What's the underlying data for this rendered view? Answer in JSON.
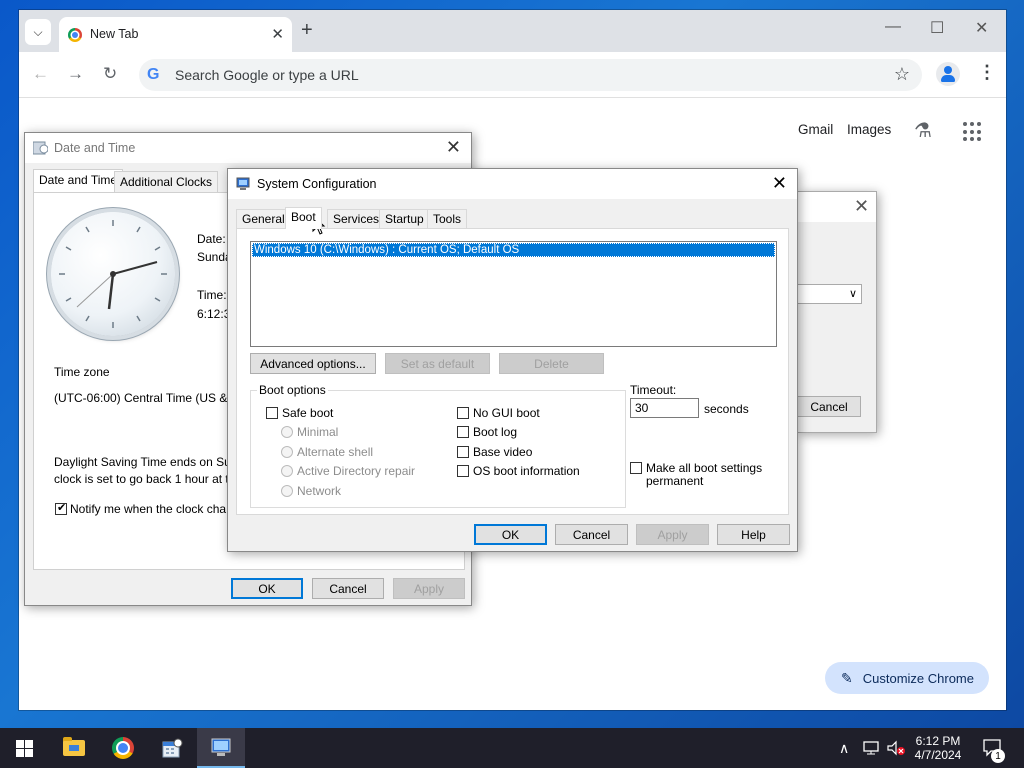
{
  "chrome": {
    "tab_title": "New Tab",
    "tab_close": "✕",
    "new_tab": "+",
    "omnibox_placeholder": "Search Google or type a URL",
    "g_logo": "G",
    "links": {
      "gmail": "Gmail",
      "images": "Images"
    },
    "customize_label": "Customize Chrome",
    "window_controls": {
      "minimize": "—",
      "maximize": "☐",
      "close": "✕"
    },
    "icons": [
      "tab-search-icon",
      "back-icon",
      "forward-icon",
      "reload-icon",
      "bookmark-star-icon",
      "profile-icon",
      "menu-icon",
      "labs-icon",
      "apps-icon",
      "pencil-icon"
    ]
  },
  "date_time_dialog": {
    "title": "Date and Time",
    "tabs": [
      "Date and Time",
      "Additional Clocks"
    ],
    "date_label": "Date:",
    "date_value": "Sunda",
    "time_label": "Time:",
    "time_value": "6:12:3",
    "timezone_label": "Time zone",
    "timezone_value": "(UTC-06:00) Central Time (US & C",
    "dst_line1": "Daylight Saving Time ends on Sur",
    "dst_line2": "clock is set to go back 1 hour at th",
    "notify_label": "Notify me when the clock cha",
    "notify_checked": true,
    "buttons": {
      "ok": "OK",
      "cancel": "Cancel",
      "apply": "Apply"
    }
  },
  "background_dialog": {
    "cancel": "Cancel"
  },
  "sysconfig": {
    "title": "System Configuration",
    "tabs": [
      "General",
      "Boot",
      "Services",
      "Startup",
      "Tools"
    ],
    "active_tab": "Boot",
    "boot_entries": [
      "Windows 10 (C:\\Windows) : Current OS; Default OS"
    ],
    "buttons_row": {
      "advanced": "Advanced options...",
      "set_default": "Set as default",
      "delete": "Delete"
    },
    "boot_options_label": "Boot options",
    "safe_boot": "Safe boot",
    "minimal": "Minimal",
    "alternate_shell": "Alternate shell",
    "ad_repair": "Active Directory repair",
    "network": "Network",
    "no_gui_boot": "No GUI boot",
    "boot_log": "Boot log",
    "base_video": "Base video",
    "os_boot_info": "OS boot information",
    "timeout_label": "Timeout:",
    "timeout_value": "30",
    "seconds_label": "seconds",
    "make_permanent_line1": "Make all boot settings",
    "make_permanent_line2": "permanent",
    "footer": {
      "ok": "OK",
      "cancel": "Cancel",
      "apply": "Apply",
      "help": "Help"
    }
  },
  "taskbar": {
    "clock_time": "6:12 PM",
    "clock_date": "4/7/2024",
    "notification_count": "1"
  }
}
